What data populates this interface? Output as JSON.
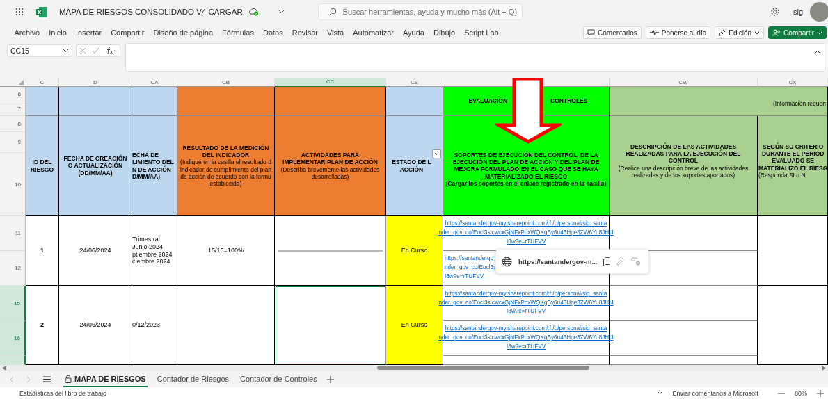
{
  "title_bar": {
    "title": "MAPA DE RIESGOS CONSOLIDADO V4 CARGAR",
    "search_placeholder": "Buscar herramientas, ayuda y mucho más (Alt + Q)",
    "user": "sig"
  },
  "menu": [
    "Archivo",
    "Inicio",
    "Insertar",
    "Compartir",
    "Diseño de página",
    "Fórmulas",
    "Datos",
    "Revisar",
    "Vista",
    "Automatizar",
    "Ayuda",
    "Dibujo",
    "Script Lab"
  ],
  "actions": [
    {
      "label": "Comentarios",
      "kind": "comments"
    },
    {
      "label": "Ponerse al día",
      "kind": "catchup"
    },
    {
      "label": "Edición",
      "kind": "mode"
    },
    {
      "label": "Compartir",
      "kind": "share"
    }
  ],
  "formula_bar": {
    "name_box": "CC15"
  },
  "columns": [
    {
      "label": "C",
      "selected": false
    },
    {
      "label": "D",
      "selected": false
    },
    {
      "label": "CA",
      "selected": false
    },
    {
      "label": "CB",
      "selected": false
    },
    {
      "label": "CC",
      "selected": true
    },
    {
      "label": "CE",
      "selected": false
    },
    {
      "selected": false
    },
    {
      "label": "CW",
      "selected": false
    },
    {
      "label": "CX",
      "selected": false
    }
  ],
  "rows": [
    {
      "label": "6",
      "selected": false
    },
    {
      "label": "7",
      "selected": false
    },
    {
      "label": "8",
      "selected": false
    },
    {
      "label": "9",
      "selected": false
    },
    {
      "label": "10",
      "selected": false
    },
    {
      "label": "11",
      "selected": false
    },
    {
      "label": "12",
      "selected": false
    },
    {
      "label": "15",
      "selected": true
    },
    {
      "label": "16",
      "selected": true
    }
  ],
  "headers": {
    "id": "ID DEL\nRIESGO",
    "created": "FECHA DE CREACIÓN\nO ACTUALIZACIÓN\n(DD/MM/AA)",
    "follow_up": "ECHA DE\nLIMIENTO DEL\nN DE ACCIÓN\nD/MM/AA)",
    "result_title": "RESULTADO DE LA MEDICIÓN\nDEL INDICADOR",
    "result_note": "(Indique en la casilla el resultado d\nindicador de cumplimiento del plan\nde acción de acuerdo con la formu\nestablecida)",
    "activities_title": "ACTIVIDADES PARA\nIMPLEMENTAR PLAN DE ACCIÓN",
    "activities_note": "(Describa brevemente las actividades\ndesarrolladas)",
    "status": "ESTADO DE L\nACCIÓN",
    "evaluation_left": "EVALUACIÓN",
    "evaluation_right": "CONTROLES",
    "supports_title": "SOPORTES DE EJECUCIÓN DEL CONTROL, DE LA\nEJECUCIÓN DEL PLAN DE ACCIÓN Y DEL PLAN DE\nMEJORA FORMULADO EN EL CASO QUE SE HAYA\nMATERIALIZADO EL RIESGO",
    "supports_note": "(Cargar los soportes en el enlace registrado en la casilla)",
    "info": "(Información requeri",
    "description_title": "DESCRIPCIÓN DE LAS ACTIVIDADES\nREALIZADAS PARA LA EJECUCIÓN DEL\nCONTROL",
    "description_note": "(Realice una descripción breve de las actividades\nrealizadas y de los soportes aportados)",
    "criteria_title": "SEGÚN SU CRITERIO\nDURANTE EL PERIOD\nEVALUADO SE\nMATERIALIZÓ EL RIESG",
    "criteria_note": "(Responda SI o N"
  },
  "records": [
    {
      "id": "1",
      "created": "24/06/2024",
      "follow_up": "Trimestral\nJunio 2024\nptiembre 2024\nciembre 2024",
      "result": "15/15=100%",
      "activities_illegible": true,
      "status": "En Curso",
      "selected": false,
      "links": [
        {
          "kind": "full",
          "text": "https://santandergov-my.sharepoint.com/:f:/g/personal/sig_santa\nnder_gov_co/Eocl3sIcwcxGjNFxPdxWQKgBy6u43Hge3ZW6Yu8JHIJ\nI8w?e=rTUFVV"
        },
        {
          "kind": "partial",
          "text": "https://santandergo\nnder_gov_co/Eocl3s\nI8w?e=rTUFVV"
        }
      ]
    },
    {
      "id": "2",
      "created": "24/06/2024",
      "follow_up": "0/12/2023",
      "activities_illegible": false,
      "status": "En Curso",
      "selected": true,
      "links": [
        {
          "kind": "full",
          "text": "https://santandergov-my.sharepoint.com/:f:/g/personal/sig_santa\nnder_gov_co/Eocl3sIcwcxGjNFxPdxWQKgBy6u43Hge3ZW6Yu8JHIJ\nI8w?e=rTUFVV"
        },
        {
          "kind": "full",
          "text": "https://santandergov-my.sharepoint.com/:f:/g/personal/sig_santa\nnder_gov_co/Eocl3sIcwcxGjNFxPdxWQKgBy6u43Hge3ZW6Yu8JHIJ\nI8w?e=rTUFVV"
        }
      ]
    }
  ],
  "link_popup": {
    "url": "https://santandergov-m..."
  },
  "sheet_tabs": [
    {
      "label": "MAPA DE RIESGOS",
      "selected": true,
      "locked": true
    },
    {
      "label": "Contador de Riesgos",
      "selected": false,
      "locked": false
    },
    {
      "label": "Contador de Controles",
      "selected": false,
      "locked": false
    }
  ],
  "status_bar": {
    "left": "Estadísticas del libro de trabajo",
    "feedback": "Enviar comentarios a Microsoft",
    "zoom": "80%"
  }
}
